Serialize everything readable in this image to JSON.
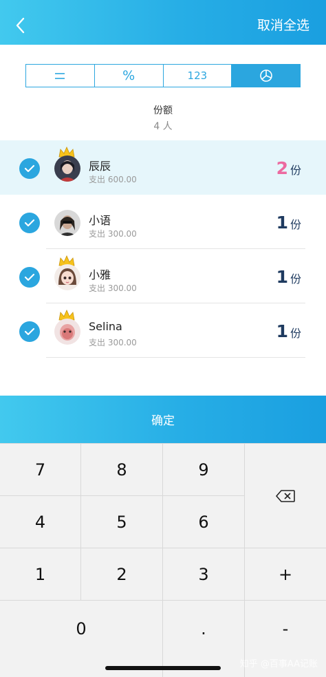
{
  "header": {
    "back_icon": "chevron-left-icon",
    "action_label": "取消全选"
  },
  "mode_tabs": [
    {
      "label": "=",
      "icon": "equal-split-icon",
      "active": false
    },
    {
      "label": "%",
      "icon": "percent-icon",
      "active": false
    },
    {
      "label": "123",
      "icon": "amount-icon",
      "active": false
    },
    {
      "label": "",
      "icon": "pie-chart-icon",
      "active": true
    }
  ],
  "summary": {
    "title": "份额",
    "count": "4 人"
  },
  "members": [
    {
      "name": "辰辰",
      "spend": "支出 600.00",
      "shares": "2",
      "unit": "份",
      "crown": true,
      "checked": true,
      "highlight": true
    },
    {
      "name": "小语",
      "spend": "支出 300.00",
      "shares": "1",
      "unit": "份",
      "crown": false,
      "checked": true,
      "highlight": false
    },
    {
      "name": "小雅",
      "spend": "支出 300.00",
      "shares": "1",
      "unit": "份",
      "crown": true,
      "checked": true,
      "highlight": false
    },
    {
      "name": "Selina",
      "spend": "支出 300.00",
      "shares": "1",
      "unit": "份",
      "crown": true,
      "checked": true,
      "highlight": false
    }
  ],
  "confirm_label": "确定",
  "keypad": {
    "k7": "7",
    "k8": "8",
    "k9": "9",
    "k4": "4",
    "k5": "5",
    "k6": "6",
    "k1": "1",
    "k2": "2",
    "k3": "3",
    "k0": "0",
    "kdot": ".",
    "plus": "+",
    "minus": "-",
    "backspace_icon": "backspace-icon"
  },
  "watermark": "知乎 @百事AA记账"
}
